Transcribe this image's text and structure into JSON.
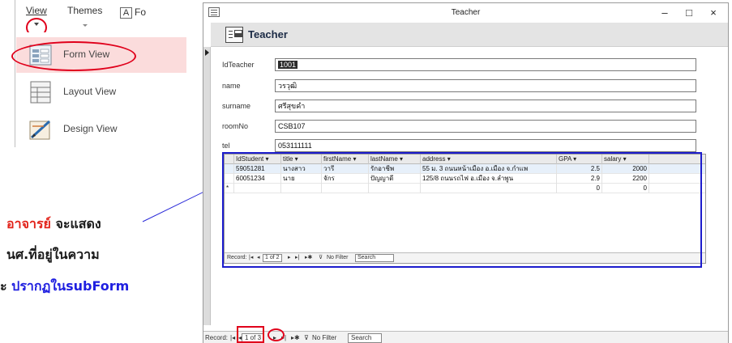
{
  "ribbon": {
    "view_tab": "View",
    "themes_tab": "Themes",
    "font_box_glyph": "A",
    "font_label": "Fo",
    "menu": [
      {
        "label": "Form View",
        "icon": "form-view-icon",
        "selected": true
      },
      {
        "label": "Layout View",
        "icon": "layout-view-icon",
        "selected": false
      },
      {
        "label": "Design View",
        "icon": "design-view-icon",
        "selected": false
      }
    ]
  },
  "note": {
    "line1_red": "อาจารย์",
    "line1_dark": " จะแสดง",
    "line2_dark": "นศ.ที่อยู่ในความ",
    "line3_dark": "ะ ",
    "line3_blue": "ปรากฏในsubForm"
  },
  "window": {
    "title": "Teacher",
    "minimize": "–",
    "maximize": "□",
    "close": "×"
  },
  "form": {
    "header_title": "Teacher",
    "fields": [
      {
        "label": "IdTeacher",
        "value": "1001"
      },
      {
        "label": "name",
        "value": "วรวุฒิ"
      },
      {
        "label": "surname",
        "value": "ศรีสุขคำ"
      },
      {
        "label": "roomNo",
        "value": "CSB107"
      },
      {
        "label": "tel",
        "value": "053111111"
      }
    ]
  },
  "subform": {
    "columns": [
      "IdStudent",
      "title",
      "firstName",
      "lastName",
      "address",
      "GPA",
      "salary"
    ],
    "rows": [
      [
        "59051281",
        "นางสาว",
        "วารี",
        "รักอาชีพ",
        "55 ม. 3 ถนนหน้าเมือง อ.เมือง จ.กำแพ",
        "2.5",
        "2000"
      ],
      [
        "60051234",
        "นาย",
        "จักร",
        "ปัญญาดี",
        "125/8 ถนนรถไฟ อ.เมือง จ.ลำพูน",
        "2.9",
        "2200"
      ]
    ],
    "new_row_marker": "*",
    "new_row_gpa": "0",
    "new_row_salary": "0",
    "nav": {
      "record_label": "Record:",
      "position": "1 of 2",
      "filter": "No Filter",
      "search": "Search"
    }
  },
  "mainnav": {
    "record_label": "Record:",
    "position": "1 of 3",
    "filter": "No Filter",
    "search": "Search"
  },
  "colors": {
    "annotation_red": "#e0001b",
    "annotation_blue": "#1c1ccd",
    "selected_menu_bg": "#fbdcdc"
  }
}
